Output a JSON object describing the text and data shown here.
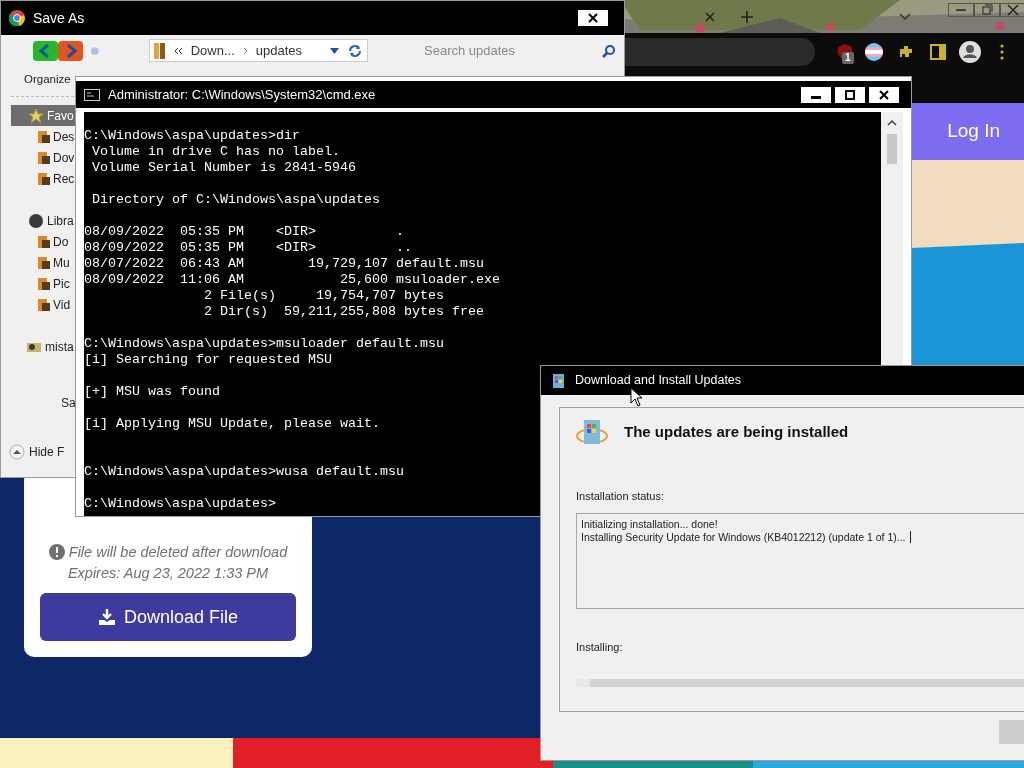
{
  "browser": {
    "extension_badge": "1",
    "header": {
      "login": "Log In"
    },
    "download_card": {
      "note": "File will be deleted after download",
      "expires": "Expires: Aug 23, 2022 1:33 PM",
      "button": "Download File"
    }
  },
  "save_as": {
    "title": "Save As",
    "breadcrumb": [
      "Down...",
      "updates"
    ],
    "search": {
      "placeholder": "Search updates"
    },
    "organize": "Organize",
    "nav": [
      {
        "label": "Favo",
        "kind": "star",
        "selected": true,
        "children": [
          {
            "label": "Des",
            "kind": "folder",
            "selected": false
          },
          {
            "label": "Dov",
            "kind": "folder",
            "selected": false
          },
          {
            "label": "Rec",
            "kind": "folder",
            "selected": false
          }
        ]
      },
      {
        "label": "Libra",
        "kind": "disc",
        "selected": false,
        "children": [
          {
            "label": "Do",
            "kind": "folder",
            "selected": false
          },
          {
            "label": "Mu",
            "kind": "folder",
            "selected": false
          },
          {
            "label": "Pic",
            "kind": "folder",
            "selected": false
          },
          {
            "label": "Vid",
            "kind": "folder",
            "selected": false
          }
        ]
      },
      {
        "label": "mista",
        "kind": "group",
        "selected": false
      }
    ],
    "save_label": "Sa",
    "hide_folders": "Hide F"
  },
  "cmd": {
    "title": "Administrator: C:\\Windows\\System32\\cmd.exe",
    "lines": [
      {
        "text": "C:\\Windows\\aspa\\updates>dir"
      },
      {
        "text": " Volume in drive C has no label."
      },
      {
        "text": " Volume Serial Number is 2841-5946"
      },
      {
        "text": " Directory of C:\\Windows\\aspa\\updates",
        "blank_before": true
      },
      {
        "text": "08/09/2022  05:35 PM    <DIR>          .",
        "blank_before": true
      },
      {
        "text": "08/09/2022  05:35 PM    <DIR>          .."
      },
      {
        "text": "08/07/2022  06:43 AM        19,729,107 default.msu"
      },
      {
        "text": "08/09/2022  11:06 AM            25,600 msuloader.exe"
      },
      {
        "text": "               2 File(s)     19,754,707 bytes"
      },
      {
        "text": "               2 Dir(s)  59,211,255,808 bytes free"
      },
      {
        "text": "C:\\Windows\\aspa\\updates>msuloader default.msu",
        "blank_before": true
      },
      {
        "text": "[i] Searching for requested MSU"
      },
      {
        "text": "[+] MSU was found",
        "blank_before": true
      },
      {
        "text": "[i] Applying MSU Update, please wait.",
        "blank_before": true
      },
      {
        "text": "C:\\Windows\\aspa\\updates>wusa default.msu",
        "blank_before": true,
        "extra_blank": true
      },
      {
        "text": "C:\\Windows\\aspa\\updates>",
        "blank_before": true
      }
    ]
  },
  "update_dialog": {
    "title": "Download and Install Updates",
    "heading": "The updates are being installed",
    "status_label": "Installation status:",
    "status_lines": [
      "Initializing installation... done!",
      "Installing Security Update for Windows (KB4012212) (update 1 of 1)..."
    ],
    "progress_label": "Installing:",
    "level": 0.03
  }
}
